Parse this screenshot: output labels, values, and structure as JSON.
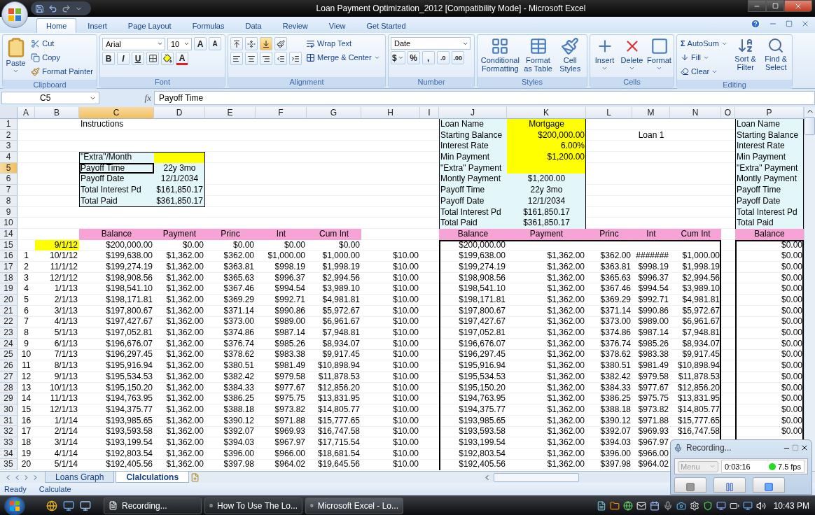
{
  "window": {
    "title": "Loan Payment Optimization_2012  [Compatibility Mode] - Microsoft Excel"
  },
  "ribbon": {
    "tabs": [
      {
        "label": "Home",
        "selected": true
      },
      {
        "label": "Insert",
        "selected": false
      },
      {
        "label": "Page Layout",
        "selected": false
      },
      {
        "label": "Formulas",
        "selected": false
      },
      {
        "label": "Data",
        "selected": false
      },
      {
        "label": "Review",
        "selected": false
      },
      {
        "label": "View",
        "selected": false
      },
      {
        "label": "Get Started",
        "selected": false
      }
    ],
    "clipboard": {
      "label": "Clipboard",
      "paste": "Paste",
      "cut": "Cut",
      "copy": "Copy",
      "format_painter": "Format Painter"
    },
    "font": {
      "label": "Font",
      "name": "Arial",
      "size": "10",
      "grow": "A",
      "shrink": "A",
      "bold": "B",
      "italic": "I",
      "underline": "U",
      "color_button": "A"
    },
    "alignment": {
      "label": "Alignment",
      "vertical": [
        {
          "selected": false
        },
        {
          "selected": false
        },
        {
          "selected": true
        }
      ],
      "wrap_text": "Wrap Text",
      "merge": "Merge & Center"
    },
    "number": {
      "label": "Number",
      "format": "Date",
      "currency": "$",
      "percent": "%",
      "comma": ",",
      "decimals": [
        ".0",
        ".00"
      ]
    },
    "styles": {
      "label": "Styles",
      "buttons": [
        "Conditional Formatting",
        "Format as Table",
        "Cell Styles"
      ]
    },
    "cells": {
      "label": "Cells",
      "buttons": [
        "Insert",
        "Delete",
        "Format"
      ]
    },
    "editing": {
      "label": "Editing",
      "autosum_symbol": "Σ",
      "autosum": "AutoSum",
      "fill": "Fill",
      "clear": "Clear",
      "sort": "Sort & Filter",
      "find": "Find & Select"
    }
  },
  "formula_bar": {
    "name_box": "C5",
    "function_label": "fx",
    "formula": "Payoff Time"
  },
  "sheet": {
    "columns": [
      {
        "label": "A",
        "selected": false
      },
      {
        "label": "B",
        "selected": false
      },
      {
        "label": "C",
        "selected": true
      },
      {
        "label": "D",
        "selected": false
      },
      {
        "label": "E",
        "selected": false
      },
      {
        "label": "F",
        "selected": false
      },
      {
        "label": "G",
        "selected": false
      },
      {
        "label": "H",
        "selected": false
      },
      {
        "label": "I",
        "selected": false
      },
      {
        "label": "J",
        "selected": false
      },
      {
        "label": "K",
        "selected": false
      },
      {
        "label": "L",
        "selected": false
      },
      {
        "label": "M",
        "selected": false
      },
      {
        "label": "N",
        "selected": false
      },
      {
        "label": "O",
        "selected": false
      },
      {
        "label": "P",
        "selected": false
      }
    ],
    "rows": [
      {
        "label": "1",
        "selected": false
      },
      {
        "label": "2",
        "selected": false
      },
      {
        "label": "3",
        "selected": false
      },
      {
        "label": "4",
        "selected": false
      },
      {
        "label": "5",
        "selected": true
      },
      {
        "label": "6",
        "selected": false
      },
      {
        "label": "7",
        "selected": false
      },
      {
        "label": "8",
        "selected": false
      },
      {
        "label": "9",
        "selected": false
      },
      {
        "label": "10",
        "selected": false
      },
      {
        "label": "14",
        "selected": false
      },
      {
        "label": "15",
        "selected": false
      },
      {
        "label": "16",
        "selected": false
      },
      {
        "label": "17",
        "selected": false
      },
      {
        "label": "18",
        "selected": false
      },
      {
        "label": "19",
        "selected": false
      },
      {
        "label": "20",
        "selected": false
      },
      {
        "label": "21",
        "selected": false
      },
      {
        "label": "22",
        "selected": false
      },
      {
        "label": "23",
        "selected": false
      },
      {
        "label": "24",
        "selected": false
      },
      {
        "label": "25",
        "selected": false
      },
      {
        "label": "26",
        "selected": false
      },
      {
        "label": "27",
        "selected": false
      },
      {
        "label": "28",
        "selected": false
      },
      {
        "label": "29",
        "selected": false
      },
      {
        "label": "30",
        "selected": false
      },
      {
        "label": "31",
        "selected": false
      },
      {
        "label": "32",
        "selected": false
      },
      {
        "label": "33",
        "selected": false
      },
      {
        "label": "34",
        "selected": false
      },
      {
        "label": "35",
        "selected": false
      }
    ],
    "instructions": "Instructions",
    "summary": [
      {
        "label": "\"Extra\"/Month",
        "input": true,
        "selected": false
      },
      {
        "label": "Payoff Time",
        "value": "22y 3mo",
        "input": false,
        "selected": true
      },
      {
        "label": "Payoff Date",
        "value": "12/1/2034",
        "input": false,
        "selected": false
      },
      {
        "label": "Total Interest Pd",
        "value": "$161,850.17",
        "input": false,
        "selected": false
      },
      {
        "label": "Total Paid",
        "value": "$361,850.17",
        "input": false,
        "selected": false
      }
    ],
    "loan": {
      "title": "Loan 1",
      "fields": [
        {
          "label": "Loan Name",
          "value": "Mortgage",
          "input": true
        },
        {
          "label": "Starting Balance",
          "value": "$200,000.00",
          "input": true
        },
        {
          "label": "Interest Rate",
          "value": "6.00%",
          "input": true
        },
        {
          "label": "Min Payment",
          "value": "$1,200.00",
          "input": true
        },
        {
          "label": "\"Extra\" Payment",
          "input": true
        },
        {
          "label": "Montly Payment",
          "value": "$1,200.00",
          "input": false
        },
        {
          "label": "Payoff Time",
          "value": "22y 3mo",
          "input": false
        },
        {
          "label": "Payoff Date",
          "value": "12/1/2034",
          "input": false
        },
        {
          "label": "Total Interest Pd",
          "value": "$161,850.17",
          "input": false
        },
        {
          "label": "Total Paid",
          "value": "$361,850.17",
          "input": false
        }
      ]
    },
    "loan_2": {
      "fields": [
        "Loan Name",
        "Starting Balance",
        "Interest Rate",
        "Min Payment",
        "\"Extra\" Payment",
        "Montly Payment",
        "Payoff Time",
        "Payoff Date",
        "Total Interest Pd",
        "Total Paid"
      ]
    },
    "schedule": {
      "headers": [
        "Balance",
        "Payment",
        "Princ",
        "Int",
        "Cum Int"
      ],
      "rows": [
        {
          "date": "9/1/12",
          "balance": "$200,000.00",
          "payment": "$0.00",
          "princ": "$0.00",
          "int": "$0.00",
          "cum_int": "$0.00"
        },
        {
          "n": "1",
          "date": "10/1/12",
          "balance": "$199,638.00",
          "payment": "$1,362.00",
          "princ": "$362.00",
          "int": "$1,000.00",
          "cum_int": "$1,000.00",
          "extra": "$10.00"
        },
        {
          "n": "2",
          "date": "11/1/12",
          "balance": "$199,274.19",
          "payment": "$1,362.00",
          "princ": "$363.81",
          "int": "$998.19",
          "cum_int": "$1,998.19",
          "extra": "$10.00"
        },
        {
          "n": "3",
          "date": "12/1/12",
          "balance": "$198,908.56",
          "payment": "$1,362.00",
          "princ": "$365.63",
          "int": "$996.37",
          "cum_int": "$2,994.56",
          "extra": "$10.00"
        },
        {
          "n": "4",
          "date": "1/1/13",
          "balance": "$198,541.10",
          "payment": "$1,362.00",
          "princ": "$367.46",
          "int": "$994.54",
          "cum_int": "$3,989.10",
          "extra": "$10.00"
        },
        {
          "n": "5",
          "date": "2/1/13",
          "balance": "$198,171.81",
          "payment": "$1,362.00",
          "princ": "$369.29",
          "int": "$992.71",
          "cum_int": "$4,981.81",
          "extra": "$10.00"
        },
        {
          "n": "6",
          "date": "3/1/13",
          "balance": "$197,800.67",
          "payment": "$1,362.00",
          "princ": "$371.14",
          "int": "$990.86",
          "cum_int": "$5,972.67",
          "extra": "$10.00"
        },
        {
          "n": "7",
          "date": "4/1/13",
          "balance": "$197,427.67",
          "payment": "$1,362.00",
          "princ": "$373.00",
          "int": "$989.00",
          "cum_int": "$6,961.67",
          "extra": "$10.00"
        },
        {
          "n": "8",
          "date": "5/1/13",
          "balance": "$197,052.81",
          "payment": "$1,362.00",
          "princ": "$374.86",
          "int": "$987.14",
          "cum_int": "$7,948.81",
          "extra": "$10.00"
        },
        {
          "n": "9",
          "date": "6/1/13",
          "balance": "$196,676.07",
          "payment": "$1,362.00",
          "princ": "$376.74",
          "int": "$985.26",
          "cum_int": "$8,934.07",
          "extra": "$10.00"
        },
        {
          "n": "10",
          "date": "7/1/13",
          "balance": "$196,297.45",
          "payment": "$1,362.00",
          "princ": "$378.62",
          "int": "$983.38",
          "cum_int": "$9,917.45",
          "extra": "$10.00"
        },
        {
          "n": "11",
          "date": "8/1/13",
          "balance": "$195,916.94",
          "payment": "$1,362.00",
          "princ": "$380.51",
          "int": "$981.49",
          "cum_int": "$10,898.94",
          "extra": "$10.00"
        },
        {
          "n": "12",
          "date": "9/1/13",
          "balance": "$195,534.53",
          "payment": "$1,362.00",
          "princ": "$382.42",
          "int": "$979.58",
          "cum_int": "$11,878.53",
          "extra": "$10.00"
        },
        {
          "n": "13",
          "date": "10/1/13",
          "balance": "$195,150.20",
          "payment": "$1,362.00",
          "princ": "$384.33",
          "int": "$977.67",
          "cum_int": "$12,856.20",
          "extra": "$10.00"
        },
        {
          "n": "14",
          "date": "11/1/13",
          "balance": "$194,763.95",
          "payment": "$1,362.00",
          "princ": "$386.25",
          "int": "$975.75",
          "cum_int": "$13,831.95",
          "extra": "$10.00"
        },
        {
          "n": "15",
          "date": "12/1/13",
          "balance": "$194,375.77",
          "payment": "$1,362.00",
          "princ": "$388.18",
          "int": "$973.82",
          "cum_int": "$14,805.77",
          "extra": "$10.00"
        },
        {
          "n": "16",
          "date": "1/1/14",
          "balance": "$193,985.65",
          "payment": "$1,362.00",
          "princ": "$390.12",
          "int": "$971.88",
          "cum_int": "$15,777.65",
          "extra": "$10.00"
        },
        {
          "n": "17",
          "date": "2/1/14",
          "balance": "$193,593.58",
          "payment": "$1,362.00",
          "princ": "$392.07",
          "int": "$969.93",
          "cum_int": "$16,747.58",
          "extra": "$10.00"
        },
        {
          "n": "18",
          "date": "3/1/14",
          "balance": "$193,199.54",
          "payment": "$1,362.00",
          "princ": "$394.03",
          "int": "$967.97",
          "cum_int": "$17,715.54",
          "extra": "$10.00"
        },
        {
          "n": "19",
          "date": "4/1/14",
          "balance": "$192,803.54",
          "payment": "$1,362.00",
          "princ": "$396.00",
          "int": "$966.00",
          "cum_int": "$18,681.54",
          "extra": "$10.00"
        },
        {
          "n": "20",
          "date": "5/1/14",
          "balance": "$192,405.56",
          "payment": "$1,362.00",
          "princ": "$397.98",
          "int": "$964.02",
          "cum_int": "$19,645.56",
          "extra": "$10.00"
        }
      ]
    },
    "schedule_2": {
      "headers": [
        "Balance",
        "Payment",
        "Princ",
        "Int",
        "Cum Int"
      ],
      "rows": [
        {
          "balance": "$200,000.00"
        },
        {
          "balance": "$199,638.00",
          "payment": "$1,362.00",
          "princ": "$362.00",
          "int": "#######",
          "cum_int": "$1,000.00"
        },
        {
          "balance": "$199,274.19",
          "payment": "$1,362.00",
          "princ": "$363.81",
          "int": "$998.19",
          "cum_int": "$1,998.19"
        },
        {
          "balance": "$198,908.56",
          "payment": "$1,362.00",
          "princ": "$365.63",
          "int": "$996.37",
          "cum_int": "$2,994.56"
        },
        {
          "balance": "$198,541.10",
          "payment": "$1,362.00",
          "princ": "$367.46",
          "int": "$994.54",
          "cum_int": "$3,989.10"
        },
        {
          "balance": "$198,171.81",
          "payment": "$1,362.00",
          "princ": "$369.29",
          "int": "$992.71",
          "cum_int": "$4,981.81"
        },
        {
          "balance": "$197,800.67",
          "payment": "$1,362.00",
          "princ": "$371.14",
          "int": "$990.86",
          "cum_int": "$5,972.67"
        },
        {
          "balance": "$197,427.67",
          "payment": "$1,362.00",
          "princ": "$373.00",
          "int": "$989.00",
          "cum_int": "$6,961.67"
        },
        {
          "balance": "$197,052.81",
          "payment": "$1,362.00",
          "princ": "$374.86",
          "int": "$987.14",
          "cum_int": "$7,948.81"
        },
        {
          "balance": "$196,676.07",
          "payment": "$1,362.00",
          "princ": "$376.74",
          "int": "$985.26",
          "cum_int": "$8,934.07"
        },
        {
          "balance": "$196,297.45",
          "payment": "$1,362.00",
          "princ": "$378.62",
          "int": "$983.38",
          "cum_int": "$9,917.45"
        },
        {
          "balance": "$195,916.94",
          "payment": "$1,362.00",
          "princ": "$380.51",
          "int": "$981.49",
          "cum_int": "$10,898.94"
        },
        {
          "balance": "$195,534.53",
          "payment": "$1,362.00",
          "princ": "$382.42",
          "int": "$979.58",
          "cum_int": "$11,878.53"
        },
        {
          "balance": "$195,150.20",
          "payment": "$1,362.00",
          "princ": "$384.33",
          "int": "$977.67",
          "cum_int": "$12,856.20"
        },
        {
          "balance": "$194,763.95",
          "payment": "$1,362.00",
          "princ": "$386.25",
          "int": "$975.75",
          "cum_int": "$13,831.95"
        },
        {
          "balance": "$194,375.77",
          "payment": "$1,362.00",
          "princ": "$388.18",
          "int": "$973.82",
          "cum_int": "$14,805.77"
        },
        {
          "balance": "$193,985.65",
          "payment": "$1,362.00",
          "princ": "$390.12",
          "int": "$971.88",
          "cum_int": "$15,777.65"
        },
        {
          "balance": "$193,593.58",
          "payment": "$1,362.00",
          "princ": "$392.07",
          "int": "$969.93",
          "cum_int": "$16,747.58"
        },
        {
          "balance": "$193,199.54",
          "payment": "$1,362.00",
          "princ": "$394.03",
          "int": "$967.97"
        },
        {
          "balance": "$192,803.54",
          "payment": "$1,362.00",
          "princ": "$396.00",
          "int": "$966.00"
        },
        {
          "balance": "$192,405.56",
          "payment": "$1,362.00",
          "princ": "$397.98",
          "int": "$964.02"
        }
      ]
    },
    "schedule_3": {
      "headers": [
        "Balance"
      ],
      "rows": [
        "$0.00",
        "$0.00",
        "$0.00",
        "$0.00",
        "$0.00",
        "$0.00",
        "$0.00",
        "$0.00",
        "$0.00",
        "$0.00",
        "$0.00",
        "$0.00",
        "$0.00",
        "$0.00",
        "$0.00",
        "$0.00",
        "$0.00",
        "$0.00"
      ]
    }
  },
  "sheet_tabs": [
    {
      "label": "Loans Graph",
      "selected": false
    },
    {
      "label": "Clalculations",
      "selected": true
    }
  ],
  "status_bar": [
    "Ready",
    "Calculate"
  ],
  "recorder": {
    "title": "Recording...",
    "menu": "Menu",
    "time": "0:03:16",
    "fps": "7.5 fps"
  },
  "taskbar": {
    "tasks": [
      {
        "label": "Recording...",
        "selected": false
      },
      {
        "label": "How To Use The Lo...",
        "selected": false
      },
      {
        "label": "Microsoft Excel - Lo...",
        "selected": true
      }
    ],
    "clock": "10:43 PM"
  }
}
